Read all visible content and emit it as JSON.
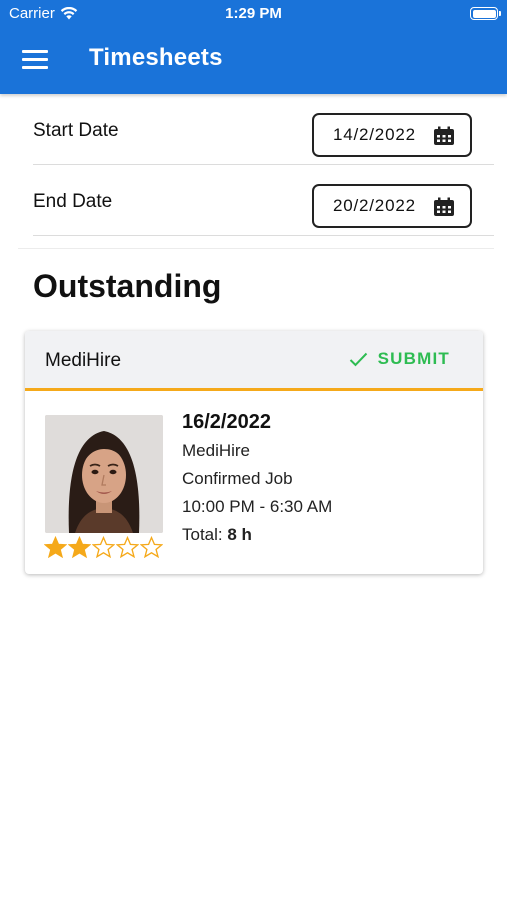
{
  "status_bar": {
    "carrier": "Carrier",
    "time": "1:29 PM"
  },
  "app_bar": {
    "title": "Timesheets",
    "menu_icon": "hamburger-menu-icon"
  },
  "filters": {
    "start_date": {
      "label": "Start Date",
      "value": "14/2/2022"
    },
    "end_date": {
      "label": "End Date",
      "value": "20/2/2022"
    }
  },
  "section": {
    "title": "Outstanding"
  },
  "timesheet": {
    "company": "MediHire",
    "submit_label": "SUBMIT",
    "date": "16/2/2022",
    "client": "MediHire",
    "status": "Confirmed Job",
    "hours_range": "10:00 PM - 6:30 AM",
    "total_label": "Total:",
    "total_value": "8 h",
    "rating": 2,
    "rating_max": 5
  },
  "colors": {
    "primary": "#1a73d9",
    "accent_orange": "#f5a91a",
    "submit_green": "#2ebc52",
    "star": "#f5a91a"
  }
}
